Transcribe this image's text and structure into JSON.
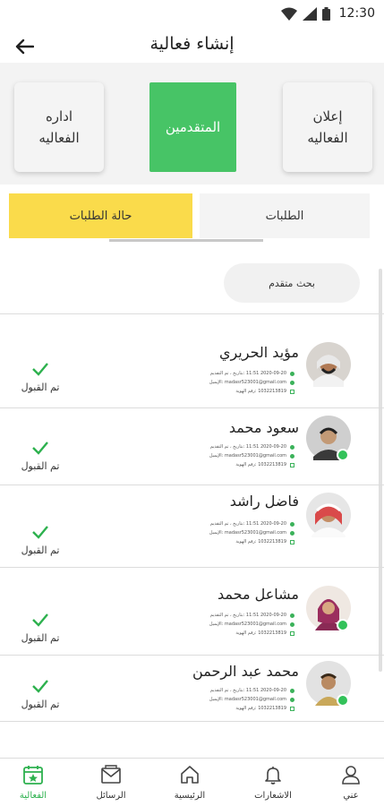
{
  "status_bar": {
    "time": "12:30"
  },
  "header": {
    "title": "إنشاء  فعالية"
  },
  "steps": [
    {
      "line1": "إعلان",
      "line2": "الفعاليه"
    },
    {
      "line1": "المتقدمين",
      "line2": ""
    },
    {
      "line1": "اداره",
      "line2": "الفعاليه"
    }
  ],
  "tabs": {
    "requests": "الطلبات",
    "requests_status": "حالة الطلبات"
  },
  "search": {
    "label": "بحث متقدم"
  },
  "applicants": [
    {
      "name": "مؤيد الحريري",
      "date": "2020-09-20 11:51 :بتاريخ ، تم التقديم",
      "email": "madasr523001@gmail.com :الإيميل",
      "id_no": "1032213819 :رقم الهوية",
      "status": "تم القبول",
      "online": false
    },
    {
      "name": "سعود محمد",
      "date": "2020-09-20 11:51 :بتاريخ ، تم التقديم",
      "email": "madasr523001@gmail.com :الإيميل",
      "id_no": "1032213819 :رقم الهوية",
      "status": "تم القبول",
      "online": true
    },
    {
      "name": "فاضل راشد",
      "date": "2020-09-20 11:51 :بتاريخ ، تم التقديم",
      "email": "madasr523001@gmail.com :الإيميل",
      "id_no": "1032213819 :رقم الهوية",
      "status": "تم القبول",
      "online": false
    },
    {
      "name": "مشاعل محمد",
      "date": "2020-09-20 11:51 :بتاريخ ، تم التقديم",
      "email": "madasr523001@gmail.com :الإيميل",
      "id_no": "1032213819 :رقم الهوية",
      "status": "تم القبول",
      "online": true
    },
    {
      "name": "محمد عبد الرحمن",
      "date": "2020-09-20 11:51 :بتاريخ ، تم التقديم",
      "email": "madasr523001@gmail.com :الإيميل",
      "id_no": "1032213819 :رقم الهوية",
      "status": "تم القبول",
      "online": true
    }
  ],
  "bottom_nav": {
    "events": "الفعالية",
    "messages": "الرسائل",
    "home": "الرئيسية",
    "notifications": "الاشعارات",
    "me": "عني"
  },
  "colors": {
    "primary_green": "#47c466",
    "tab_yellow": "#fadb4b",
    "active_nav": "#2db14e"
  }
}
